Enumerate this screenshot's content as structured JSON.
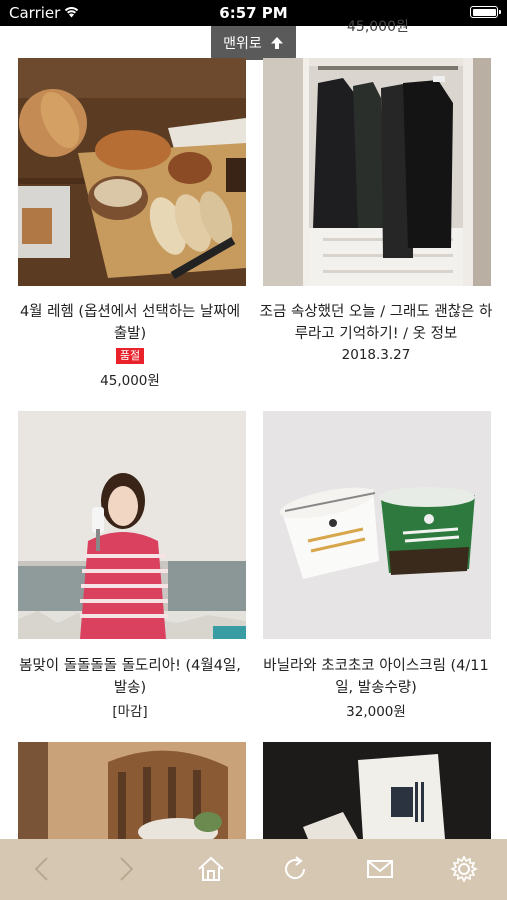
{
  "status": {
    "carrier": "Carrier",
    "time": "6:57 PM"
  },
  "top_price": "45,000원",
  "to_top": {
    "label": "맨위로"
  },
  "products": [
    {
      "title": "4월 레헴 (옵션에서 선택하는 날짜에 출발)",
      "badge": "품절",
      "price": "45,000원"
    },
    {
      "title": "조금 속상했던 오늘 / 그래도 괜찮은 하루라고 기억하기! / 옷 정보",
      "date": "2018.3.27"
    },
    {
      "title": "봄맞이 돌돌돌돌 돌도리아! (4월4일, 발송)",
      "status": "[마감]"
    },
    {
      "title": "바닐라와 초코초코 아이스크림 (4/11일, 발송수량)",
      "price": "32,000원"
    }
  ],
  "toolbar": {
    "icons": [
      "back-icon",
      "forward-icon",
      "home-icon",
      "refresh-icon",
      "mail-icon",
      "settings-icon"
    ]
  },
  "colors": {
    "tabbar": "#d6c7b3",
    "soldout_badge": "#e8212b",
    "to_top_bg": "#5a5a5a"
  }
}
